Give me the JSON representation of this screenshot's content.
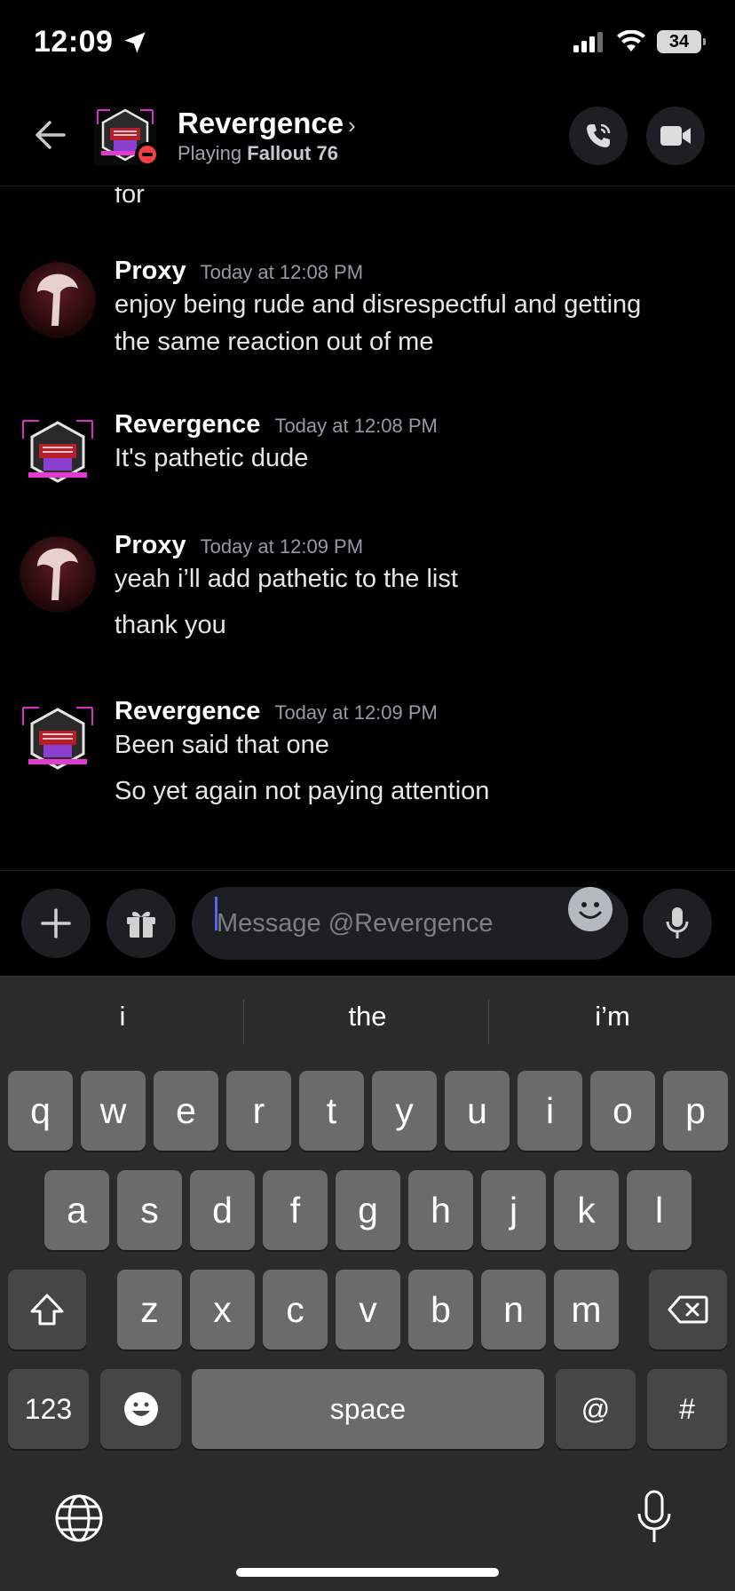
{
  "status_bar": {
    "time": "12:09",
    "battery": "34"
  },
  "header": {
    "name": "Revergence",
    "activity_prefix": "Playing",
    "activity_game": "Fallout 76"
  },
  "messages": {
    "cut_text": "for",
    "items": [
      {
        "author": "Proxy",
        "time": "Today at 12:08 PM",
        "lines": [
          "enjoy being rude and disrespectful and getting",
          "the same reaction out of me"
        ]
      },
      {
        "author": "Revergence",
        "time": "Today at 12:08 PM",
        "lines": [
          "It's pathetic dude"
        ]
      },
      {
        "author": "Proxy",
        "time": "Today at 12:09 PM",
        "lines": [
          "yeah i’ll add pathetic to the list",
          "thank you"
        ]
      },
      {
        "author": "Revergence",
        "time": "Today at 12:09 PM",
        "lines": [
          "Been said that one",
          "So yet again not paying attention"
        ]
      }
    ]
  },
  "composer": {
    "placeholder": "Message @Revergence"
  },
  "keyboard": {
    "suggestions": [
      "i",
      "the",
      "i’m"
    ],
    "row1": [
      "q",
      "w",
      "e",
      "r",
      "t",
      "y",
      "u",
      "i",
      "o",
      "p"
    ],
    "row2": [
      "a",
      "s",
      "d",
      "f",
      "g",
      "h",
      "j",
      "k",
      "l"
    ],
    "row3": [
      "z",
      "x",
      "c",
      "v",
      "b",
      "n",
      "m"
    ],
    "numbers_key": "123",
    "space_key": "space",
    "at_key": "@",
    "hash_key": "#"
  },
  "colors": {
    "accent": "#5865f2",
    "dnd": "#f23f43",
    "background": "#000000",
    "keyboard": "#2b2b2b"
  }
}
